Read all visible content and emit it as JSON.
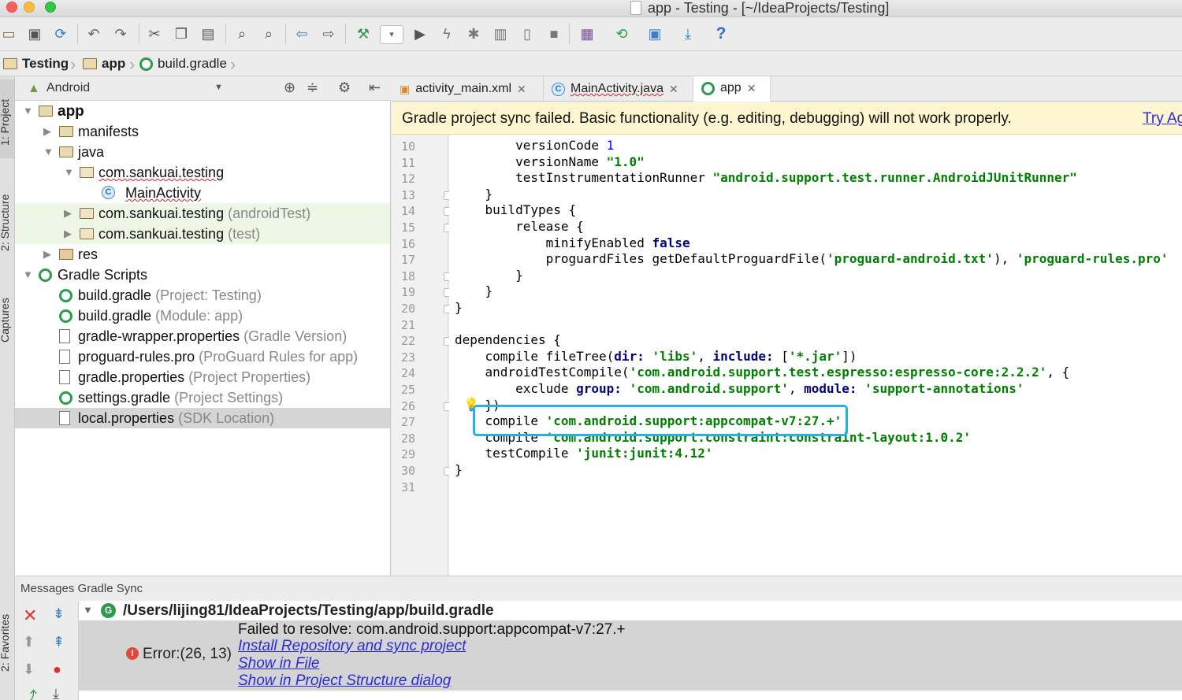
{
  "window": {
    "title": "app - Testing - [~/IdeaProjects/Testing]"
  },
  "toolbar": {
    "icons": [
      "open-folder-icon",
      "save-icon",
      "sync-icon",
      "undo-icon",
      "redo-icon",
      "cut-icon",
      "copy-icon",
      "paste-icon",
      "find-icon",
      "replace-icon",
      "back-icon",
      "forward-icon",
      "build-hammer-icon",
      "run-config-dropdown",
      "run-icon",
      "apply-changes-icon",
      "debug-icon",
      "profile-icon",
      "attach-debugger-icon",
      "stop-icon",
      "avd-manager-icon",
      "sync-gradle-icon",
      "project-structure-icon",
      "sdk-manager-icon",
      "help-icon"
    ],
    "help_label": "?"
  },
  "breadcrumb": {
    "items": [
      "Testing",
      "app",
      "build.gradle"
    ]
  },
  "left_strip": {
    "tabs": [
      "1: Project",
      "2: Structure",
      "Captures",
      "2: Favorites"
    ]
  },
  "project_panel": {
    "view_selector": "Android",
    "tree": [
      {
        "label": "app",
        "suffix": "",
        "level": 0,
        "icon": "module-folder-icon",
        "expanded": true
      },
      {
        "label": "manifests",
        "suffix": "",
        "level": 1,
        "icon": "folder-icon",
        "expanded": false
      },
      {
        "label": "java",
        "suffix": "",
        "level": 1,
        "icon": "folder-icon",
        "expanded": true
      },
      {
        "label": "com.sankuai.testing",
        "suffix": "",
        "level": 2,
        "icon": "package-icon",
        "expanded": true
      },
      {
        "label": "MainActivity",
        "suffix": "",
        "level": 3,
        "icon": "class-icon"
      },
      {
        "label": "com.sankuai.testing",
        "suffix": "(androidTest)",
        "level": 2,
        "icon": "package-icon",
        "expanded": false
      },
      {
        "label": "com.sankuai.testing",
        "suffix": "(test)",
        "level": 2,
        "icon": "package-icon",
        "expanded": false
      },
      {
        "label": "res",
        "suffix": "",
        "level": 1,
        "icon": "res-folder-icon",
        "expanded": false
      },
      {
        "label": "Gradle Scripts",
        "suffix": "",
        "level": 0,
        "icon": "gradle-icon",
        "expanded": true
      },
      {
        "label": "build.gradle",
        "suffix": "(Project: Testing)",
        "level": 1,
        "icon": "gradle-icon"
      },
      {
        "label": "build.gradle",
        "suffix": "(Module: app)",
        "level": 1,
        "icon": "gradle-icon"
      },
      {
        "label": "gradle-wrapper.properties",
        "suffix": "(Gradle Version)",
        "level": 1,
        "icon": "properties-file-icon"
      },
      {
        "label": "proguard-rules.pro",
        "suffix": "(ProGuard Rules for app)",
        "level": 1,
        "icon": "text-file-icon"
      },
      {
        "label": "gradle.properties",
        "suffix": "(Project Properties)",
        "level": 1,
        "icon": "properties-file-icon"
      },
      {
        "label": "settings.gradle",
        "suffix": "(Project Settings)",
        "level": 1,
        "icon": "gradle-icon"
      },
      {
        "label": "local.properties",
        "suffix": "(SDK Location)",
        "level": 1,
        "icon": "properties-file-icon",
        "selected": true
      }
    ]
  },
  "editor_tabs": [
    {
      "label": "activity_main.xml",
      "active": false
    },
    {
      "label": "MainActivity.java",
      "active": false
    },
    {
      "label": "app",
      "active": true
    }
  ],
  "banner": {
    "message": "Gradle project sync failed. Basic functionality (e.g. editing, debugging) will not work properly.",
    "action": "Try Ag"
  },
  "code": {
    "lines": [
      {
        "n": "10",
        "t": "        versionCode 1"
      },
      {
        "n": "11",
        "t": "        versionName \"1.0\""
      },
      {
        "n": "12",
        "t": "        testInstrumentationRunner \"android.support.test.runner.AndroidJUnitRunner\""
      },
      {
        "n": "13",
        "t": "    }"
      },
      {
        "n": "14",
        "t": "    buildTypes {"
      },
      {
        "n": "15",
        "t": "        release {"
      },
      {
        "n": "16",
        "t": "            minifyEnabled false"
      },
      {
        "n": "17",
        "t": "            proguardFiles getDefaultProguardFile('proguard-android.txt'), 'proguard-rules.pro'"
      },
      {
        "n": "18",
        "t": "        }"
      },
      {
        "n": "19",
        "t": "    }"
      },
      {
        "n": "20",
        "t": "}"
      },
      {
        "n": "21",
        "t": ""
      },
      {
        "n": "22",
        "t": "dependencies {"
      },
      {
        "n": "23",
        "t": "    compile fileTree(dir: 'libs', include: ['*.jar'])"
      },
      {
        "n": "24",
        "t": "    androidTestCompile('com.android.support.test.espresso:espresso-core:2.2.2', {"
      },
      {
        "n": "25",
        "t": "        exclude group: 'com.android.support', module: 'support-annotations'"
      },
      {
        "n": "26",
        "t": "    })"
      },
      {
        "n": "27",
        "t": "    compile 'com.android.support:appcompat-v7:27.+'"
      },
      {
        "n": "28",
        "t": "    compile 'com.android.support.constraint:constraint-layout:1.0.2'"
      },
      {
        "n": "29",
        "t": "    testCompile 'junit:junit:4.12'"
      },
      {
        "n": "30",
        "t": "}"
      },
      {
        "n": "31",
        "t": ""
      }
    ]
  },
  "messages": {
    "title": "Messages Gradle Sync",
    "file_path": "/Users/lijing81/IdeaProjects/Testing/app/build.gradle",
    "error_location": "Error:(26, 13)",
    "error_text": "Failed to resolve: com.android.support:appcompat-v7:27.+",
    "links": [
      "Install Repository and sync project",
      "Show in File",
      "Show in Project Structure dialog"
    ]
  },
  "colors": {
    "highlight_box": "#22b4e6",
    "banner_bg": "#fef6d0",
    "string": "#008000",
    "keyword": "#000080",
    "link": "#2a2ad6"
  }
}
